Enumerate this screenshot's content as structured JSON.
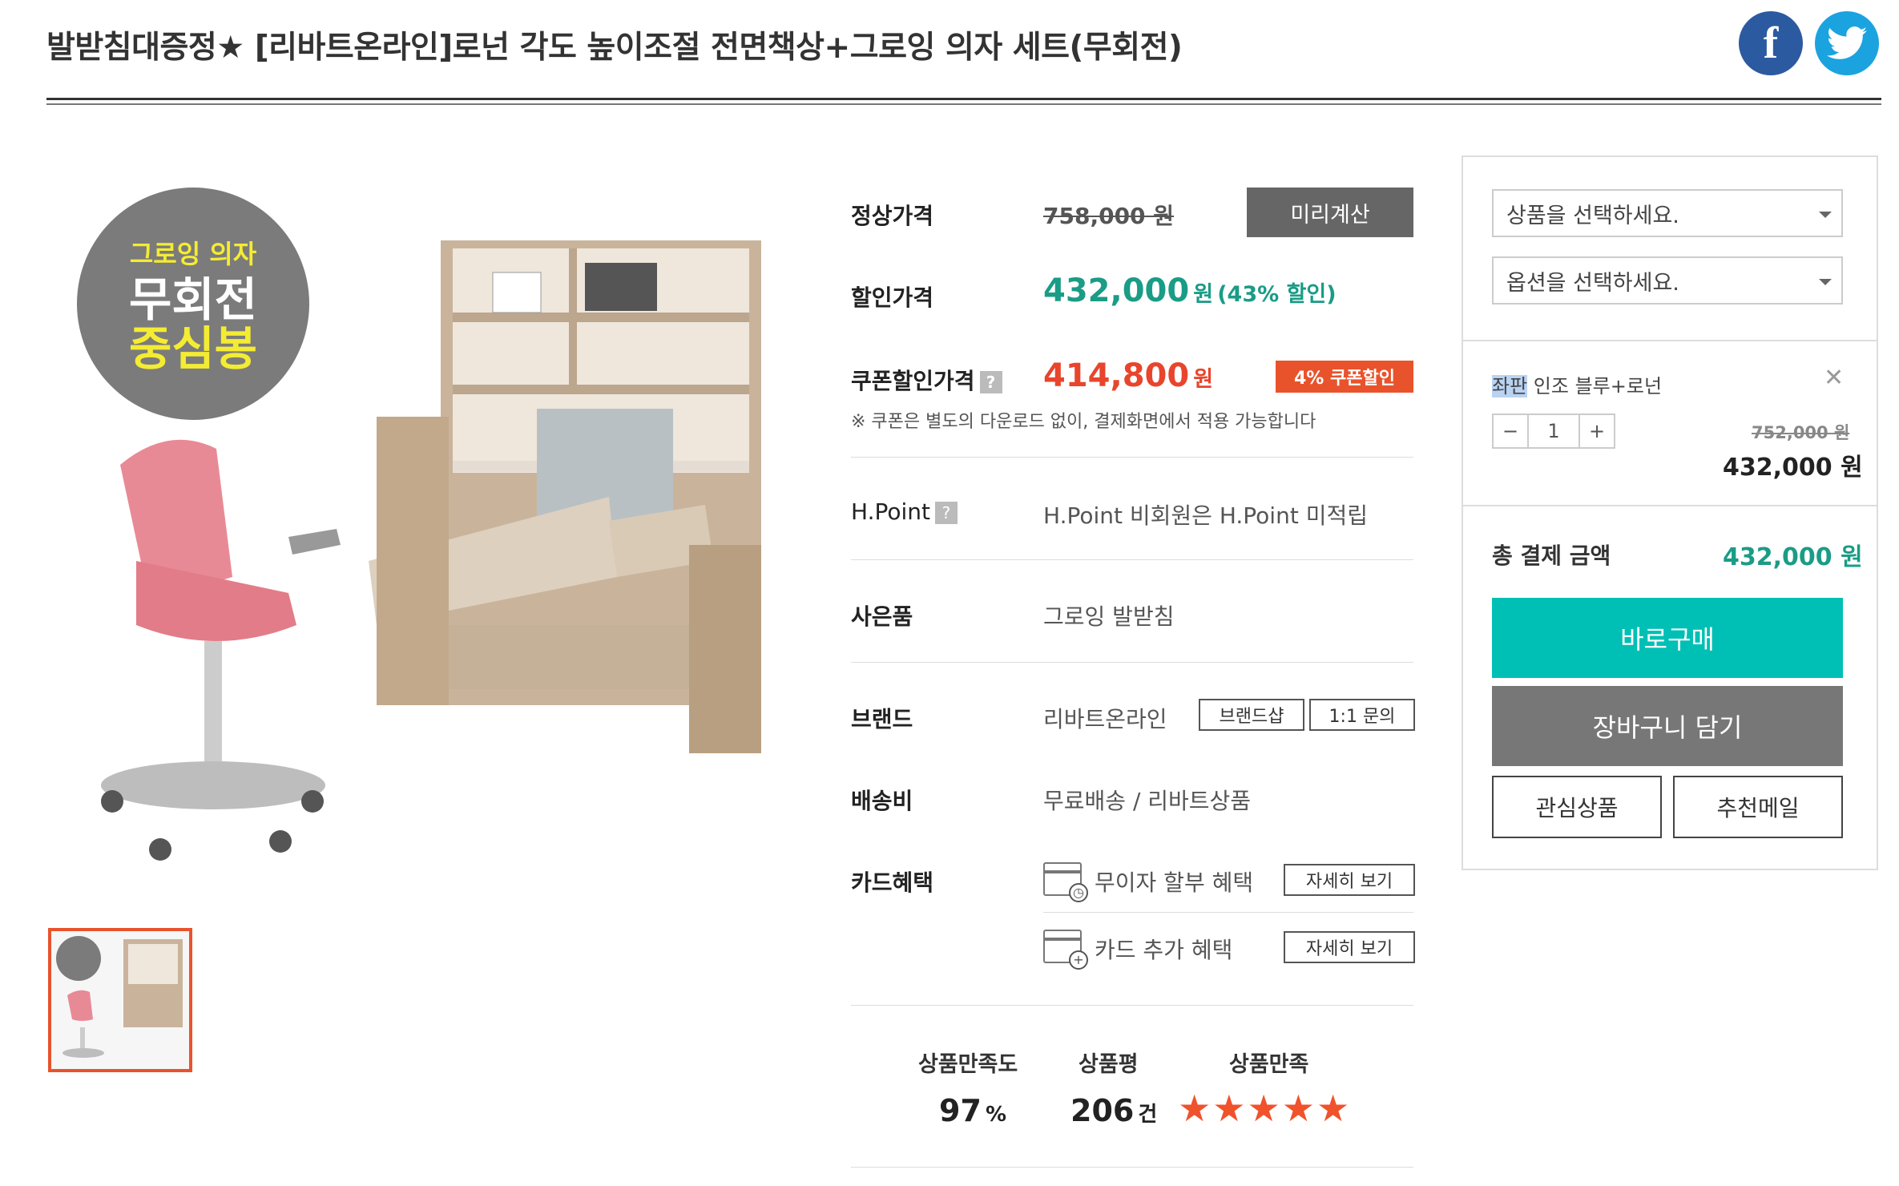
{
  "header": {
    "title": "발받침대증정★ [리바트온라인]로넌 각도 높이조절 전면책상+그로잉 의자 세트(무회전)",
    "facebook_icon": "f"
  },
  "badge": {
    "line1": "그로잉 의자",
    "line2": "무회전",
    "line3": "중심봉"
  },
  "colors": {
    "accent_green": "#1a9c86",
    "accent_red": "#e8452c",
    "teal_button": "#00c0b5",
    "gray_button": "#777777"
  },
  "price": {
    "regular_label": "정상가격",
    "regular_value": "758,000 원",
    "precalc_button": "미리계산",
    "discount_label": "할인가격",
    "discount_value": "432,000",
    "discount_unit": "원",
    "discount_rate": "(43% 할인)",
    "coupon_label": "쿠폰할인가격",
    "coupon_value": "414,800",
    "coupon_unit": "원",
    "coupon_tag": "4% 쿠폰할인",
    "coupon_note": "※ 쿠폰은 별도의 다운로드 없이, 결제화면에서 적용 가능합니다"
  },
  "hpoint": {
    "label": "H.Point",
    "value": "H.Point 비회원은 H.Point 미적립"
  },
  "gift": {
    "label": "사은품",
    "value": "그로잉 발받침"
  },
  "brand": {
    "label": "브랜드",
    "value": "리바트온라인",
    "shop_button": "브랜드샵",
    "inquiry_button": "1:1 문의"
  },
  "shipping": {
    "label": "배송비",
    "value": "무료배송 / 리바트상품"
  },
  "card": {
    "label": "카드혜택",
    "benefit1": "무이자 할부 혜택",
    "benefit2": "카드 추가 혜택",
    "detail_button": "자세히 보기"
  },
  "ratings": {
    "satisfaction_label": "상품만족도",
    "satisfaction_value": "97",
    "satisfaction_unit": "%",
    "review_label": "상품평",
    "review_value": "206",
    "review_unit": "건",
    "stars_label": "상품만족",
    "stars_value": 5,
    "stars_text": "★★★★★"
  },
  "order_panel": {
    "product_select_placeholder": "상품을 선택하세요.",
    "option_select_placeholder": "옵션을 선택하세요.",
    "selected_item_highlight": "좌판",
    "selected_item_rest": " 인조 블루+로넌",
    "qty_minus": "−",
    "qty_value": "1",
    "qty_plus": "+",
    "item_old_price": "752,000 원",
    "item_price": "432,000 원",
    "total_label": "총 결제 금액",
    "total_value": "432,000 원",
    "buy_now": "바로구매",
    "add_cart": "장바구니 담기",
    "wishlist": "관심상품",
    "recommend_mail": "추천메일"
  }
}
